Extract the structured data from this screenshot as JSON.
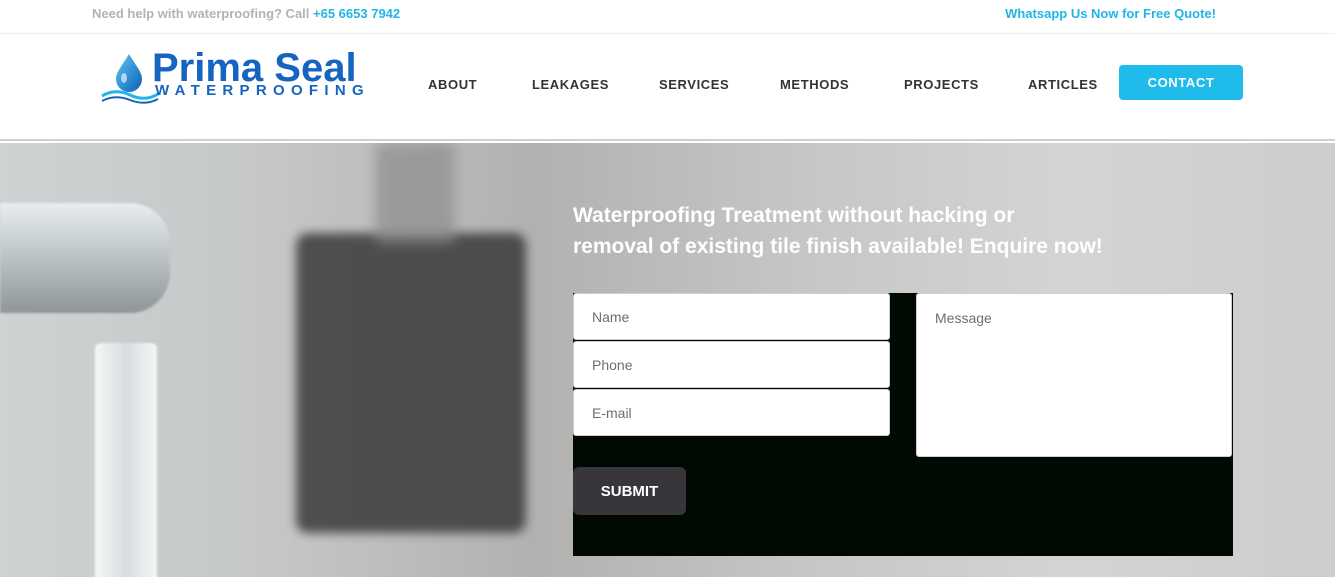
{
  "topbar": {
    "help_text": "Need help with waterproofing? Call ",
    "phone": "+65 6653 7942",
    "whatsapp": "Whatsapp Us Now for Free Quote!"
  },
  "logo": {
    "brand": "Prima Seal",
    "tagline": "WATERPROOFING"
  },
  "nav": {
    "items": [
      "ABOUT",
      "LEAKAGES",
      "SERVICES",
      "METHODS",
      "PROJECTS",
      "ARTICLES"
    ],
    "contact": "CONTACT"
  },
  "hero": {
    "headline_line1": "Waterproofing Treatment without hacking or",
    "headline_line2": "removal of existing tile finish available! Enquire now!"
  },
  "form": {
    "name_placeholder": "Name",
    "phone_placeholder": "Phone",
    "email_placeholder": "E-mail",
    "message_placeholder": "Message",
    "submit_label": "SUBMIT"
  },
  "colors": {
    "accent": "#1fbbea",
    "brand": "#1565c0",
    "form_bg": "#000a02",
    "submit_bg": "#38363b"
  }
}
